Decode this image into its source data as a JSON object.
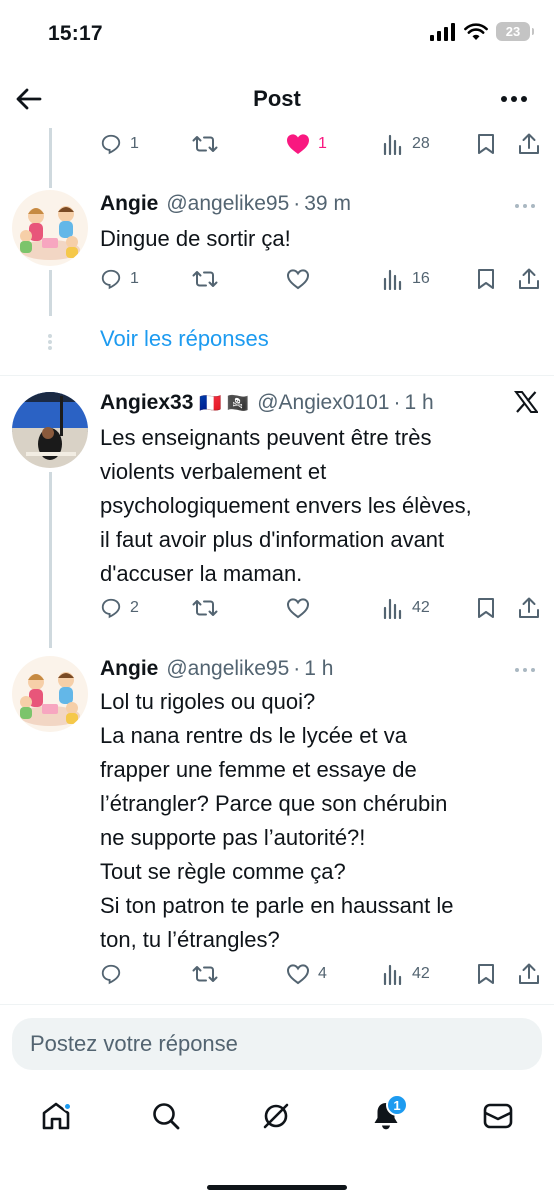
{
  "status_bar": {
    "time": "15:17",
    "battery": "23"
  },
  "header": {
    "title": "Post",
    "back_icon": "arrow-left-icon",
    "more_icon": "more-horizontal-icon"
  },
  "top_actions": {
    "replies": "1",
    "retweets": "",
    "likes": "1",
    "views": "28",
    "liked": true
  },
  "tweets": [
    {
      "name": "Angie",
      "handle": "@angelike95",
      "time": "39 m",
      "text": "Dingue de sortir ça!",
      "replies": "1",
      "retweets": "",
      "likes": "",
      "views": "16"
    },
    {
      "name": "Angiex33",
      "flags": "🇫🇷 🏴‍☠️",
      "handle": "@Angiex0101",
      "time": "1 h",
      "text_lines": [
        "Les enseignants peuvent être très",
        "violents verbalement et",
        "psychologiquement envers les élèves,",
        "il faut avoir plus d'information avant",
        "d'accuser la maman."
      ],
      "replies": "2",
      "retweets": "",
      "likes": "",
      "views": "42"
    },
    {
      "name": "Angie",
      "handle": "@angelike95",
      "time": "1 h",
      "text_lines": [
        "Lol tu rigoles ou quoi?",
        "La nana rentre ds le lycée et va",
        "frapper une femme et essaye de",
        "l’étrangler? Parce que son chérubin",
        "ne supporte pas l’autorité?!",
        "Tout se règle comme ça?",
        "Si ton patron te parle en haussant le",
        "ton, tu l’étrangles?"
      ],
      "replies": "",
      "retweets": "",
      "likes": "4",
      "views": "42"
    }
  ],
  "show_replies": "Voir les réponses",
  "composer": {
    "placeholder": "Postez votre réponse"
  },
  "nav": {
    "notifications_count": "1"
  },
  "colors": {
    "accent": "#1d9bf0",
    "like": "#f91880",
    "muted": "#536471",
    "text": "#0f1419"
  }
}
